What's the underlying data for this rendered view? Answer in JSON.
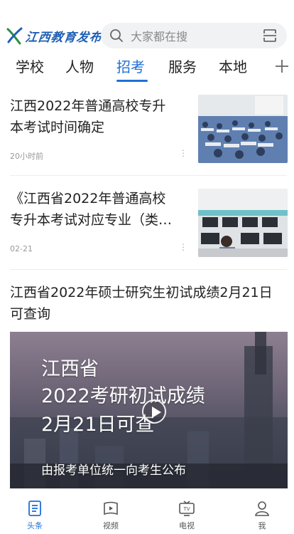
{
  "header": {
    "logo_text": "江西教育发布",
    "search_placeholder": "大家都在搜"
  },
  "tabs": [
    {
      "label": "学校"
    },
    {
      "label": "人物"
    },
    {
      "label": "招考"
    },
    {
      "label": "服务"
    },
    {
      "label": "本地"
    }
  ],
  "active_tab": "招考",
  "feed": [
    {
      "title_line1": "江西2022年普通高校专升",
      "title_line2": "本考试时间确定",
      "time": "20小时前"
    },
    {
      "title_line1": "《江西省2022年普通高校",
      "title_line2": "专升本考试对应专业（类…",
      "time": "02-21"
    },
    {
      "title_line1": "江西省2022年硕士研究生初试成绩2月21日",
      "title_line2": "可查询"
    }
  ],
  "video": {
    "line1": "江西省",
    "line2": "2022考研初试成绩",
    "line3": "2月21日可查",
    "line4": "由报考单位统一向考生公布"
  },
  "bottom_nav": [
    {
      "label": "头条"
    },
    {
      "label": "视频"
    },
    {
      "label": "电视"
    },
    {
      "label": "我"
    }
  ],
  "colors": {
    "accent": "#1f6fd8",
    "logo": "#1f5fb5",
    "text": "#222222",
    "muted": "#999999"
  }
}
